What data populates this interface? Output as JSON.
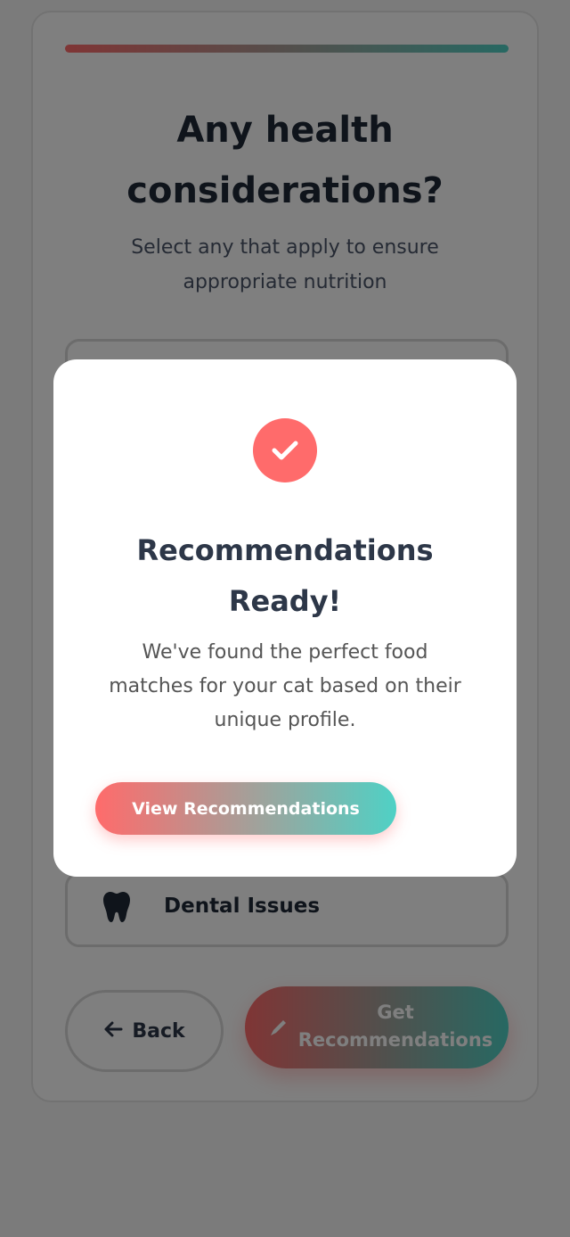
{
  "quiz": {
    "title": "Any health considerations?",
    "subtitle": "Select any that apply to ensure appropriate nutrition",
    "options": [
      {
        "label": "",
        "icon": "option-icon"
      },
      {
        "label": "Dental Issues",
        "icon": "tooth-icon"
      }
    ],
    "back_label": "Back",
    "get_label": "Get Recommendations"
  },
  "modal": {
    "title": "Recommendations Ready!",
    "text": "We've found the perfect food matches for your cat based on their unique profile.",
    "button_label": "View Recommendations",
    "icon": "checkmark-icon"
  },
  "colors": {
    "accent_coral": "#ff6b6b",
    "accent_teal": "#4fd1c5",
    "overlay": "rgba(0,0,0,0.5)"
  }
}
